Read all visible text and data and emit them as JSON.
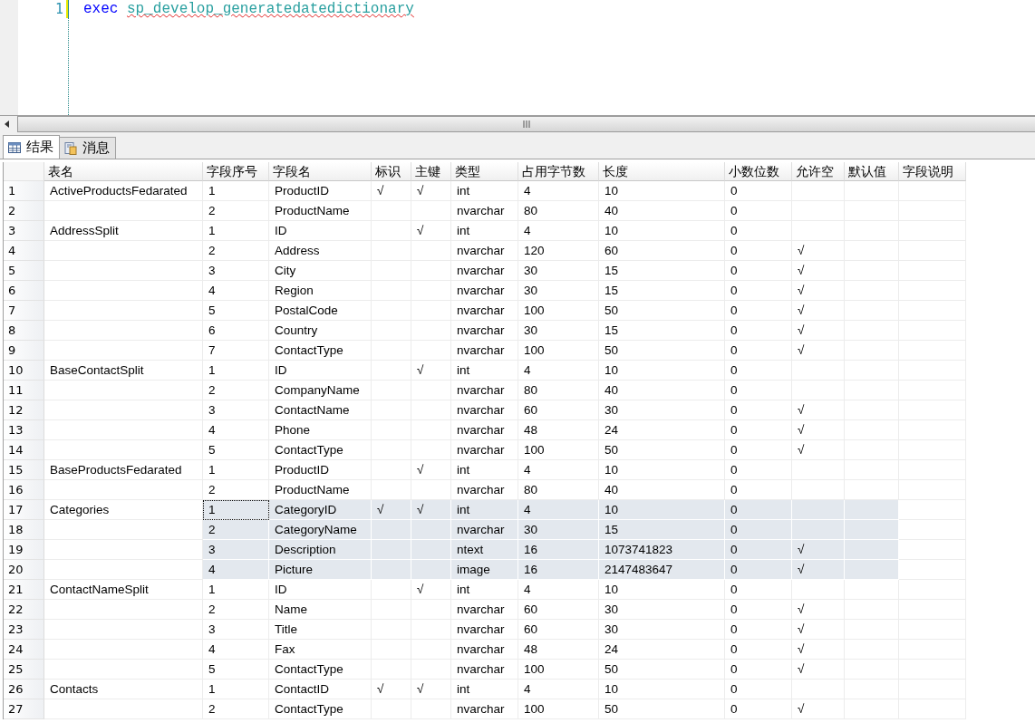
{
  "editor": {
    "line_number": "1",
    "keyword": "exec",
    "procedure": "sp_develop_generatedatedictionary"
  },
  "tabs": [
    {
      "label": "结果",
      "kind": "grid",
      "selected": true
    },
    {
      "label": "消息",
      "kind": "messages",
      "selected": false
    }
  ],
  "table": {
    "columns": [
      "表名",
      "字段序号",
      "字段名",
      "标识",
      "主键",
      "类型",
      "占用字节数",
      "长度",
      "小数位数",
      "允许空",
      "默认值",
      "字段说明"
    ],
    "rows": [
      {
        "num": "1",
        "table": "ActiveProductsFedarated",
        "seq": "1",
        "field": "ProductID",
        "identity": "√",
        "pk": "√",
        "type": "int",
        "bytes": "4",
        "length": "10",
        "scale": "0",
        "selected": false,
        "focused": false
      },
      {
        "num": "2",
        "seq": "2",
        "field": "ProductName",
        "type": "nvarchar",
        "bytes": "80",
        "length": "40",
        "scale": "0",
        "selected": false,
        "focused": false
      },
      {
        "num": "3",
        "table": "AddressSplit",
        "seq": "1",
        "field": "ID",
        "pk": "√",
        "type": "int",
        "bytes": "4",
        "length": "10",
        "scale": "0",
        "selected": false,
        "focused": false
      },
      {
        "num": "4",
        "seq": "2",
        "field": "Address",
        "type": "nvarchar",
        "bytes": "120",
        "length": "60",
        "scale": "0",
        "nullable": "√",
        "selected": false,
        "focused": false
      },
      {
        "num": "5",
        "seq": "3",
        "field": "City",
        "type": "nvarchar",
        "bytes": "30",
        "length": "15",
        "scale": "0",
        "nullable": "√",
        "selected": false,
        "focused": false
      },
      {
        "num": "6",
        "seq": "4",
        "field": "Region",
        "type": "nvarchar",
        "bytes": "30",
        "length": "15",
        "scale": "0",
        "nullable": "√",
        "selected": false,
        "focused": false
      },
      {
        "num": "7",
        "seq": "5",
        "field": "PostalCode",
        "type": "nvarchar",
        "bytes": "100",
        "length": "50",
        "scale": "0",
        "nullable": "√",
        "selected": false,
        "focused": false
      },
      {
        "num": "8",
        "seq": "6",
        "field": "Country",
        "type": "nvarchar",
        "bytes": "30",
        "length": "15",
        "scale": "0",
        "nullable": "√",
        "selected": false,
        "focused": false
      },
      {
        "num": "9",
        "seq": "7",
        "field": "ContactType",
        "type": "nvarchar",
        "bytes": "100",
        "length": "50",
        "scale": "0",
        "nullable": "√",
        "selected": false,
        "focused": false
      },
      {
        "num": "10",
        "table": "BaseContactSplit",
        "seq": "1",
        "field": "ID",
        "pk": "√",
        "type": "int",
        "bytes": "4",
        "length": "10",
        "scale": "0",
        "selected": false,
        "focused": false
      },
      {
        "num": "11",
        "seq": "2",
        "field": "CompanyName",
        "type": "nvarchar",
        "bytes": "80",
        "length": "40",
        "scale": "0",
        "selected": false,
        "focused": false
      },
      {
        "num": "12",
        "seq": "3",
        "field": "ContactName",
        "type": "nvarchar",
        "bytes": "60",
        "length": "30",
        "scale": "0",
        "nullable": "√",
        "selected": false,
        "focused": false
      },
      {
        "num": "13",
        "seq": "4",
        "field": "Phone",
        "type": "nvarchar",
        "bytes": "48",
        "length": "24",
        "scale": "0",
        "nullable": "√",
        "selected": false,
        "focused": false
      },
      {
        "num": "14",
        "seq": "5",
        "field": "ContactType",
        "type": "nvarchar",
        "bytes": "100",
        "length": "50",
        "scale": "0",
        "nullable": "√",
        "selected": false,
        "focused": false
      },
      {
        "num": "15",
        "table": "BaseProductsFedarated",
        "seq": "1",
        "field": "ProductID",
        "pk": "√",
        "type": "int",
        "bytes": "4",
        "length": "10",
        "scale": "0",
        "selected": false,
        "focused": false
      },
      {
        "num": "16",
        "seq": "2",
        "field": "ProductName",
        "type": "nvarchar",
        "bytes": "80",
        "length": "40",
        "scale": "0",
        "selected": false,
        "focused": false
      },
      {
        "num": "17",
        "table": "Categories",
        "seq": "1",
        "field": "CategoryID",
        "identity": "√",
        "pk": "√",
        "type": "int",
        "bytes": "4",
        "length": "10",
        "scale": "0",
        "selected": true,
        "focused": true
      },
      {
        "num": "18",
        "seq": "2",
        "field": "CategoryName",
        "type": "nvarchar",
        "bytes": "30",
        "length": "15",
        "scale": "0",
        "selected": true,
        "focused": false
      },
      {
        "num": "19",
        "seq": "3",
        "field": "Description",
        "type": "ntext",
        "bytes": "16",
        "length": "1073741823",
        "scale": "0",
        "nullable": "√",
        "selected": true,
        "focused": false
      },
      {
        "num": "20",
        "seq": "4",
        "field": "Picture",
        "type": "image",
        "bytes": "16",
        "length": "2147483647",
        "scale": "0",
        "nullable": "√",
        "selected": true,
        "focused": false
      },
      {
        "num": "21",
        "table": "ContactNameSplit",
        "seq": "1",
        "field": "ID",
        "pk": "√",
        "type": "int",
        "bytes": "4",
        "length": "10",
        "scale": "0",
        "selected": false,
        "focused": false
      },
      {
        "num": "22",
        "seq": "2",
        "field": "Name",
        "type": "nvarchar",
        "bytes": "60",
        "length": "30",
        "scale": "0",
        "nullable": "√",
        "selected": false,
        "focused": false
      },
      {
        "num": "23",
        "seq": "3",
        "field": "Title",
        "type": "nvarchar",
        "bytes": "60",
        "length": "30",
        "scale": "0",
        "nullable": "√",
        "selected": false,
        "focused": false
      },
      {
        "num": "24",
        "seq": "4",
        "field": "Fax",
        "type": "nvarchar",
        "bytes": "48",
        "length": "24",
        "scale": "0",
        "nullable": "√",
        "selected": false,
        "focused": false
      },
      {
        "num": "25",
        "seq": "5",
        "field": "ContactType",
        "type": "nvarchar",
        "bytes": "100",
        "length": "50",
        "scale": "0",
        "nullable": "√",
        "selected": false,
        "focused": false
      },
      {
        "num": "26",
        "table": "Contacts",
        "seq": "1",
        "field": "ContactID",
        "identity": "√",
        "pk": "√",
        "type": "int",
        "bytes": "4",
        "length": "10",
        "scale": "0",
        "selected": false,
        "focused": false
      },
      {
        "num": "27",
        "seq": "2",
        "field": "ContactType",
        "type": "nvarchar",
        "bytes": "100",
        "length": "50",
        "scale": "0",
        "nullable": "√",
        "selected": false,
        "focused": false
      }
    ]
  }
}
